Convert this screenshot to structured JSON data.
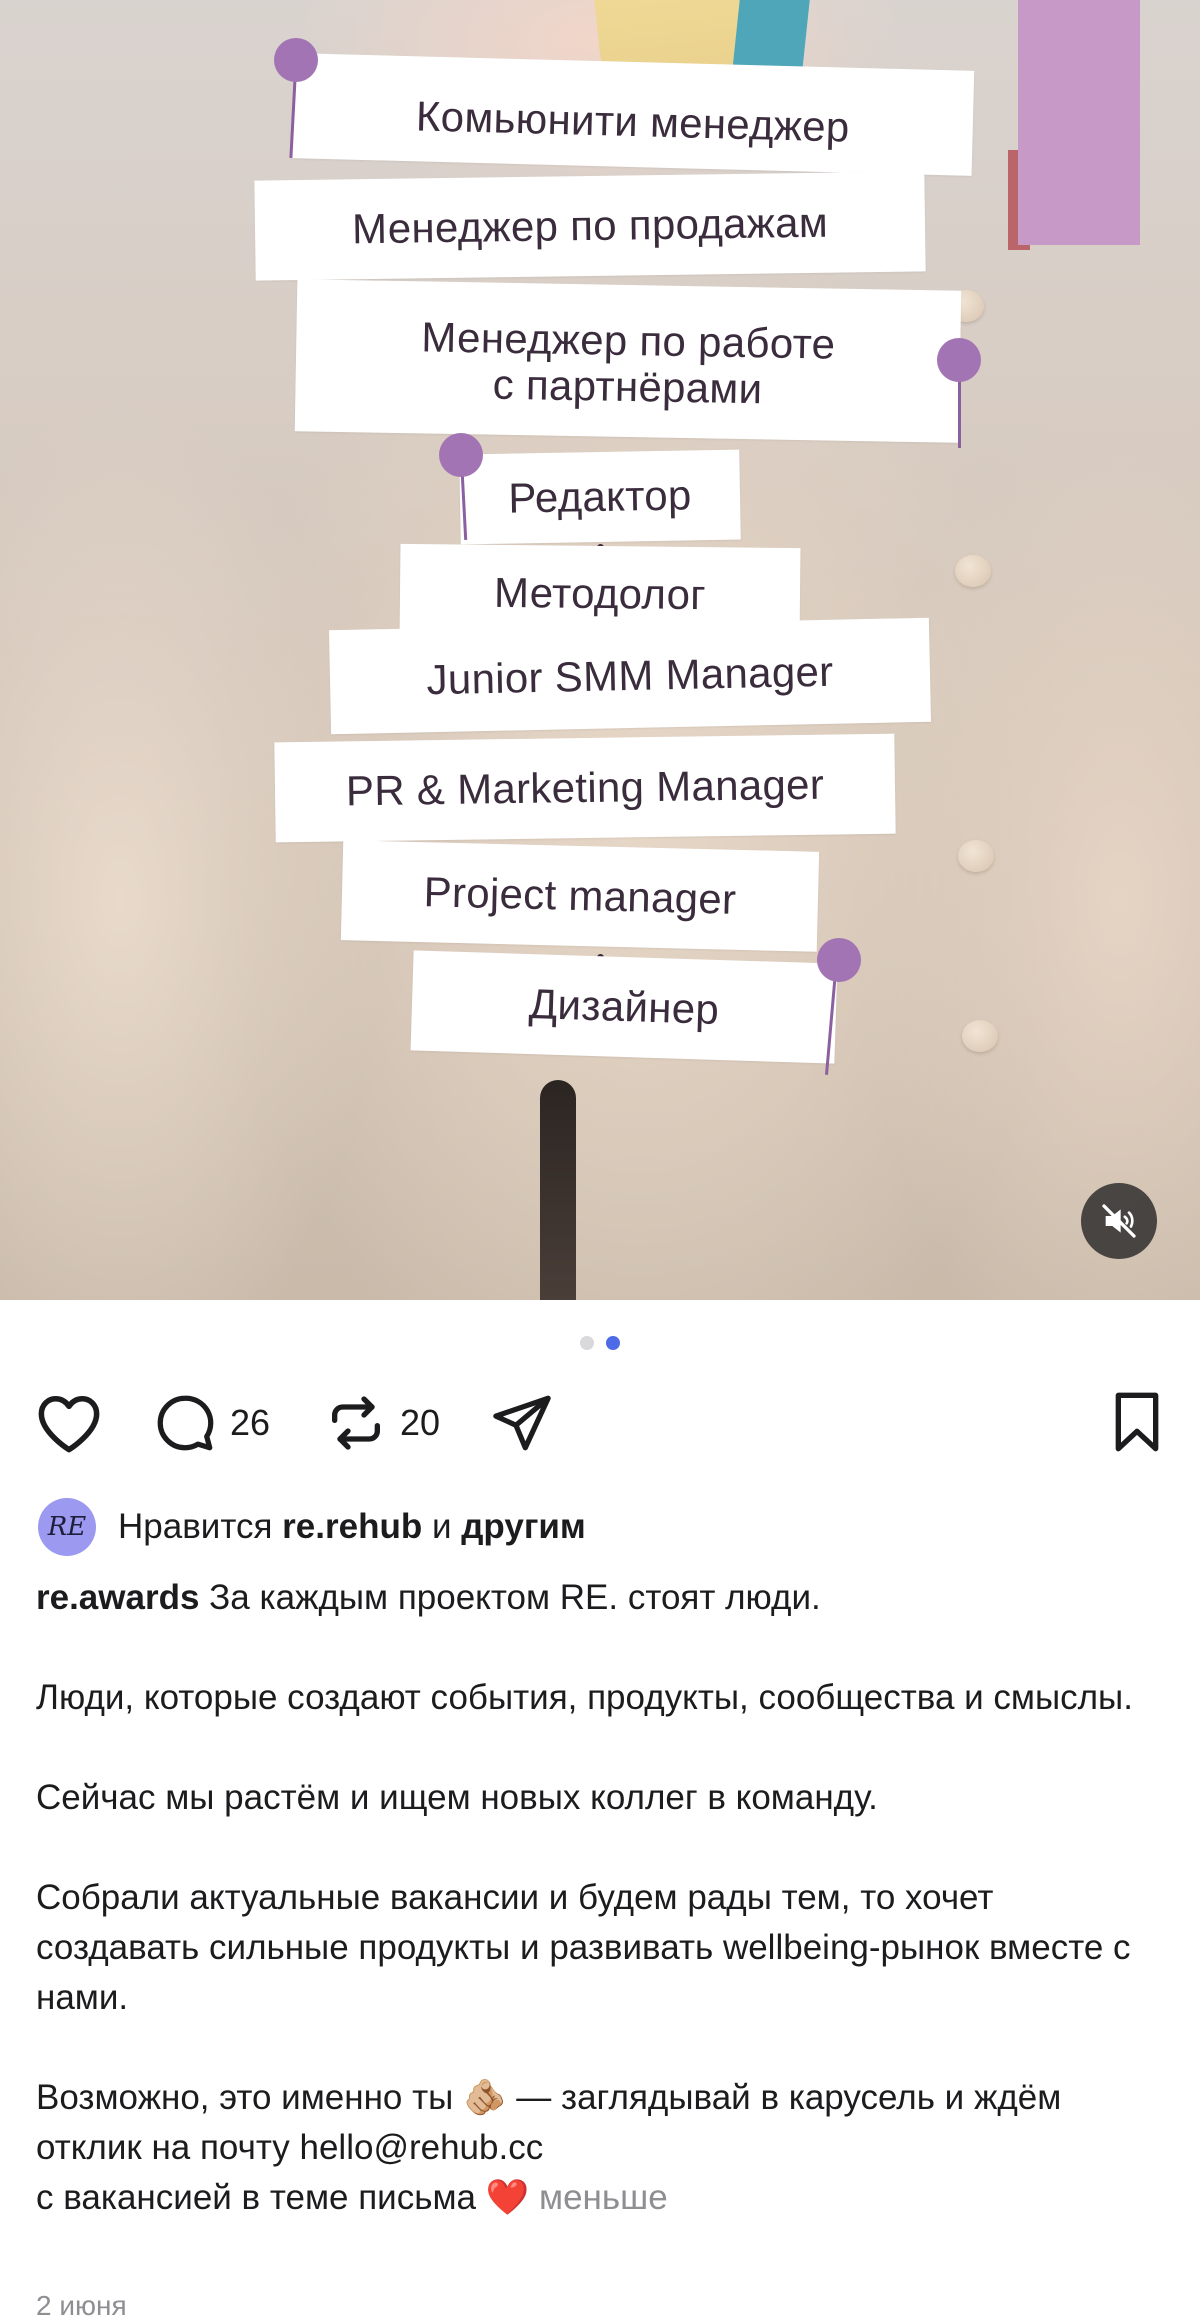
{
  "post": {
    "jobs": [
      "Комьюнити менеджер",
      "Менеджер по продажам",
      "Менеджер по работе\nс партнёрами",
      "Редактор",
      "Методолог",
      "Junior SMM Manager",
      "PR & Marketing Manager",
      "Project manager",
      "Дизайнер"
    ],
    "mute_icon": "speaker-muted-icon",
    "carousel": {
      "total": 2,
      "active_index": 1
    }
  },
  "actions": {
    "like_icon": "heart-icon",
    "comment_icon": "comment-bubble-icon",
    "comment_count": "26",
    "repost_icon": "repost-arrows-icon",
    "repost_count": "20",
    "share_icon": "paper-plane-icon",
    "save_icon": "bookmark-icon"
  },
  "likes": {
    "avatar_text": "RE",
    "prefix": "Нравится ",
    "user": "re.rehub",
    "middle": " и ",
    "others": "другим"
  },
  "caption": {
    "username": "re.awards",
    "text": " За каждым проектом RE. стоят люди.\n\nЛюди, которые создают события, продукты, сообщества и смыслы.\n\nСейчас мы растём и ищем новых коллег в команду.\n\nСобрали актуальные вакансии и будем рады тем, то хочет создавать сильные продукты и развивать wellbeing-рынок вместе с нами.\n\nВозможно, это именно ты 🫵🏼 — заглядывай в карусель и ждём отклик на почту hello@rehub.cc\nс вакансией в теме письма ❤️ ",
    "more": "меньше"
  },
  "date": "2 июня",
  "colors": {
    "accent": "#4d6be6",
    "pin": "#a274b4",
    "ribbon_pink": "#c799c6",
    "ribbon_teal": "#4fa6b8"
  }
}
